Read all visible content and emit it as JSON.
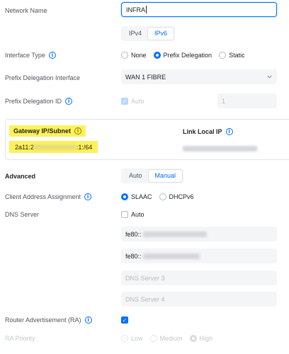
{
  "network_name": {
    "label": "Network Name",
    "value": "INFRA"
  },
  "ip_version": {
    "options": [
      "IPv4",
      "IPv6"
    ],
    "selected": "IPv6"
  },
  "interface_type": {
    "label": "Interface Type",
    "options": [
      "None",
      "Prefix Delegation",
      "Static"
    ],
    "selected": "Prefix Delegation"
  },
  "prefix_delegation_interface": {
    "label": "Prefix Delegation Interface",
    "value": "WAN 1 FIBRE"
  },
  "prefix_delegation_id": {
    "label": "Prefix Delegation ID",
    "checkbox_label": "Auto",
    "value": "1"
  },
  "gateway_panel": {
    "gateway_header": "Gateway IP/Subnet",
    "gateway_value_start": "2a11:2",
    "gateway_value_end": ":1:/64",
    "link_local_header": "Link Local IP"
  },
  "advanced": {
    "label": "Advanced",
    "options": [
      "Auto",
      "Manual"
    ],
    "selected": "Manual"
  },
  "client_address_assignment": {
    "label": "Client Address Assignment",
    "options": [
      "SLAAC",
      "DHCPv6"
    ],
    "selected": "SLAAC"
  },
  "dns_server": {
    "label": "DNS Server",
    "auto_label": "Auto",
    "server1_prefix": "fe80::",
    "server2_prefix": "fe80::",
    "server3_placeholder": "DNS Server 3",
    "server4_placeholder": "DNS Server 4"
  },
  "router_advertisement": {
    "label": "Router Advertisement (RA)"
  },
  "ra_priority": {
    "label": "RA Priority",
    "options": [
      "Low",
      "Medium",
      "High"
    ],
    "selected": "High"
  },
  "colors": {
    "accent": "#006fff",
    "highlight": "#fff15a"
  },
  "icons": [
    "info-icon",
    "chevron-down-icon",
    "check-icon"
  ]
}
